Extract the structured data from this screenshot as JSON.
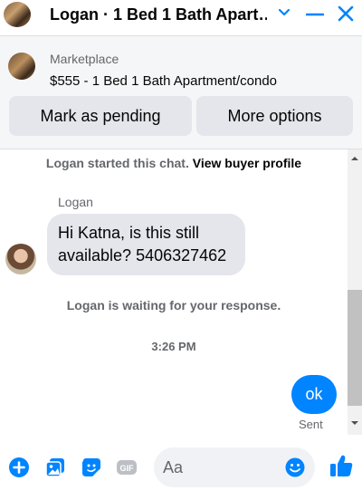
{
  "header": {
    "title": "Logan · 1 Bed 1 Bath Apart…",
    "icons": [
      "chevron-down-icon",
      "minimize-icon",
      "close-icon"
    ],
    "accent": "#0084ff"
  },
  "marketplace": {
    "label": "Marketplace",
    "listing": "$555 - 1 Bed 1 Bath Apartment/condo",
    "buttons": {
      "pending": "Mark as pending",
      "more": "More options"
    }
  },
  "chat": {
    "started_prefix": "Logan started this chat.",
    "started_link": "View buyer profile",
    "sender_name": "Logan",
    "incoming_message": "Hi Katna, is this still available? 5406327462",
    "waiting_notice": "Logan is waiting for your response.",
    "timestamp": "3:26 PM",
    "outgoing_message": "ok",
    "delivery_status": "Sent"
  },
  "composer": {
    "placeholder": "Aa",
    "icons": [
      "plus-icon",
      "photo-icon",
      "sticker-icon",
      "gif-icon",
      "emoji-icon",
      "thumbs-up-icon"
    ]
  },
  "colors": {
    "messenger_blue": "#0084ff",
    "bubble_gray": "#e4e6eb",
    "secondary_text": "#65676b"
  }
}
